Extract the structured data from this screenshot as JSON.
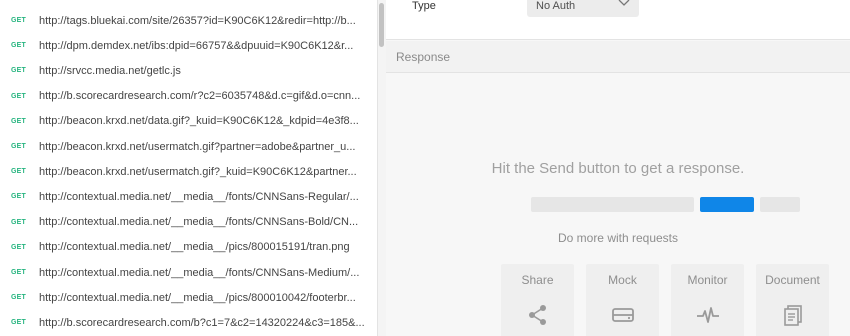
{
  "history": {
    "requests": [
      {
        "method": "GET",
        "url": "http://tags.bluekai.com/site/26357?id=K90C6K12&redir=http://b..."
      },
      {
        "method": "GET",
        "url": "http://dpm.demdex.net/ibs:dpid=66757&&dpuuid=K90C6K12&r..."
      },
      {
        "method": "GET",
        "url": "http://srvcc.media.net/getlc.js"
      },
      {
        "method": "GET",
        "url": "http://b.scorecardresearch.com/r?c2=6035748&d.c=gif&d.o=cnn..."
      },
      {
        "method": "GET",
        "url": "http://beacon.krxd.net/data.gif?_kuid=K90C6K12&_kdpid=4e3f8..."
      },
      {
        "method": "GET",
        "url": "http://beacon.krxd.net/usermatch.gif?partner=adobe&partner_u..."
      },
      {
        "method": "GET",
        "url": "http://beacon.krxd.net/usermatch.gif?_kuid=K90C6K12&partner..."
      },
      {
        "method": "GET",
        "url": "http://contextual.media.net/__media__/fonts/CNNSans-Regular/..."
      },
      {
        "method": "GET",
        "url": "http://contextual.media.net/__media__/fonts/CNNSans-Bold/CN..."
      },
      {
        "method": "GET",
        "url": "http://contextual.media.net/__media__/pics/800015191/tran.png"
      },
      {
        "method": "GET",
        "url": "http://contextual.media.net/__media__/fonts/CNNSans-Medium/..."
      },
      {
        "method": "GET",
        "url": "http://contextual.media.net/__media__/pics/800010042/footerbr..."
      },
      {
        "method": "GET",
        "url": "http://b.scorecardresearch.com/b?c1=7&c2=14320224&c3=185&..."
      }
    ]
  },
  "auth": {
    "type_label": "Type",
    "type_value": "No Auth"
  },
  "response": {
    "title": "Response",
    "hint": "Hit the Send button to get a response.",
    "do_more": "Do more with requests",
    "cards": [
      {
        "label": "Share",
        "icon": "share-icon"
      },
      {
        "label": "Mock",
        "icon": "mock-icon"
      },
      {
        "label": "Monitor",
        "icon": "monitor-icon"
      },
      {
        "label": "Document",
        "icon": "document-icon"
      }
    ]
  },
  "colors": {
    "method_get": "#26b47f",
    "accent_blue": "#0f86e8"
  }
}
